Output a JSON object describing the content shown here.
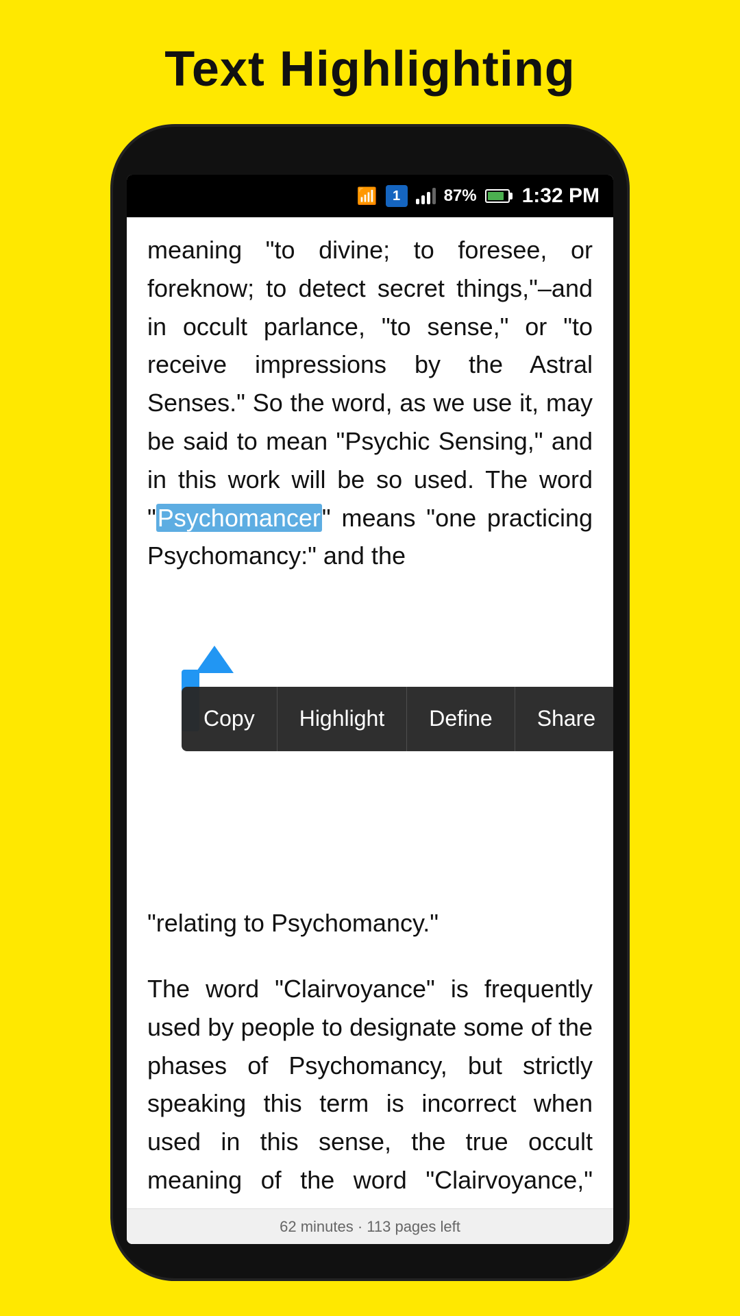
{
  "page": {
    "title": "Text Highlighting",
    "background_color": "#FFE800"
  },
  "status_bar": {
    "time": "1:32 PM",
    "battery_percent": "87%",
    "notification_number": "1"
  },
  "reading": {
    "paragraph1": "meaning \"to divine; to foresee, or foreknow; to detect secret things,\"–and in occult parlance, \"to sense,\" or \"to receive impressions by the Astral Senses.\" So the word, as we use it, may be said to mean \"Psychic Sensing,\" and in this work will be so used. The word \"",
    "highlighted_word": "Psychomancer",
    "paragraph1_after": "\" means \"one practicing Psychomancy:\" and the",
    "partial_line": "\"relating to Psychomancy.\"",
    "paragraph2": "The word \"Clairvoyance\" is frequently used by people to designate some of the phases of Psychomancy, but strictly speaking this term is incorrect when used in this sense, the true occult meaning of the word \"Clairvoyance,\" being"
  },
  "context_menu": {
    "copy_label": "Copy",
    "highlight_label": "Highlight",
    "define_label": "Define",
    "share_label": "Share"
  },
  "footer": {
    "text": "62 minutes · 113 pages left"
  }
}
